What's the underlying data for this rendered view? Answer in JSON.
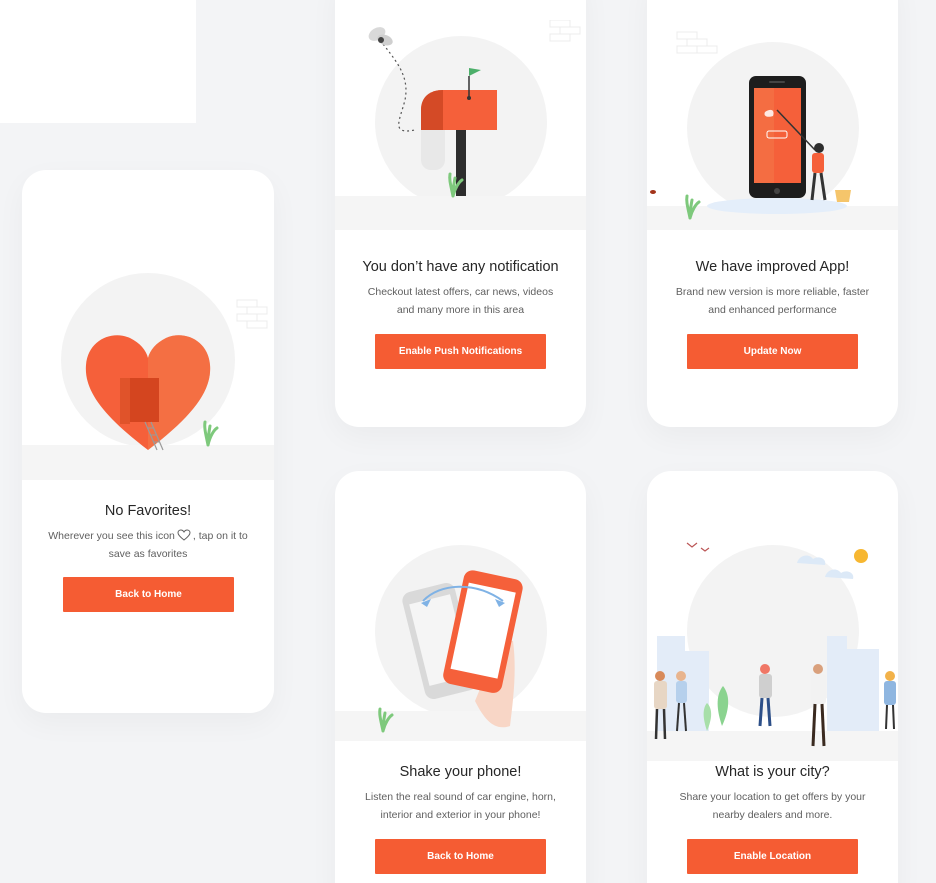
{
  "colors": {
    "accent": "#f55c33",
    "background": "#f3f4f6",
    "card": "#ffffff",
    "title": "#262626",
    "text": "#5f5f5f"
  },
  "favorites": {
    "title": "No Favorites!",
    "text_before_icon": "Wherever you see this icon",
    "text_after_icon": ", tap on it to",
    "text_line2": "save as favorites",
    "button": "Back to Home",
    "icon": "heart-outline-icon"
  },
  "notification": {
    "title": "You don’t have any notification",
    "line1": "Checkout latest offers, car news, videos",
    "line2": "and many more in this area",
    "button": "Enable Push Notifications"
  },
  "update": {
    "title": "We have improved App!",
    "line1": "Brand new version is more reliable, faster",
    "line2": "and  enhanced performance",
    "button": "Update Now"
  },
  "shake": {
    "title": "Shake your phone!",
    "line1": "Listen the real sound of car engine, horn,",
    "line2": "interior and exterior in your phone!",
    "button": "Back to Home"
  },
  "city": {
    "title": "What is your city?",
    "line1": "Share your location to get offers by your",
    "line2": "nearby dealers and more.",
    "button": "Enable Location"
  }
}
